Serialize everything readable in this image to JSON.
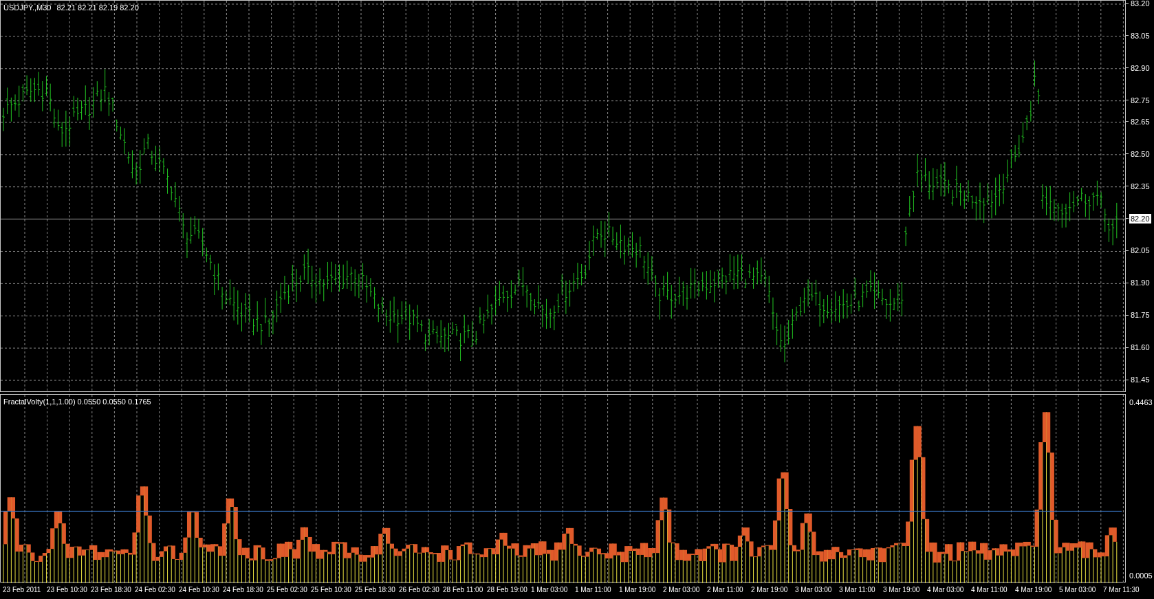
{
  "chart": {
    "symbol": "USDJPY.,M30",
    "quote": "82.21 82.21 82.19 82.20",
    "price_axis": [
      "83.20",
      "83.05",
      "82.90",
      "82.75",
      "82.65",
      "82.50",
      "82.35",
      "82.05",
      "81.90",
      "81.75",
      "81.60",
      "81.45"
    ],
    "current_price": "82.20"
  },
  "indicator": {
    "label": "FractalVolty(1,1,1.00) 0.0550 0.0550 0.1765",
    "scale_max": "0.4463",
    "scale_min": "0.0005"
  },
  "time_axis": [
    "23 Feb 2011",
    "23 Feb 10:30",
    "23 Feb 18:30",
    "24 Feb 02:30",
    "24 Feb 10:30",
    "24 Feb 18:30",
    "25 Feb 02:30",
    "25 Feb 10:30",
    "25 Feb 18:30",
    "26 Feb 02:30",
    "28 Feb 11:00",
    "28 Feb 19:00",
    "1 Mar 03:00",
    "1 Mar 11:00",
    "1 Mar 19:00",
    "2 Mar 03:00",
    "2 Mar 11:00",
    "2 Mar 19:00",
    "3 Mar 03:00",
    "3 Mar 11:00",
    "3 Mar 19:00",
    "4 Mar 03:00",
    "4 Mar 11:00",
    "4 Mar 19:00",
    "5 Mar 03:00",
    "7 Mar 11:30"
  ]
}
